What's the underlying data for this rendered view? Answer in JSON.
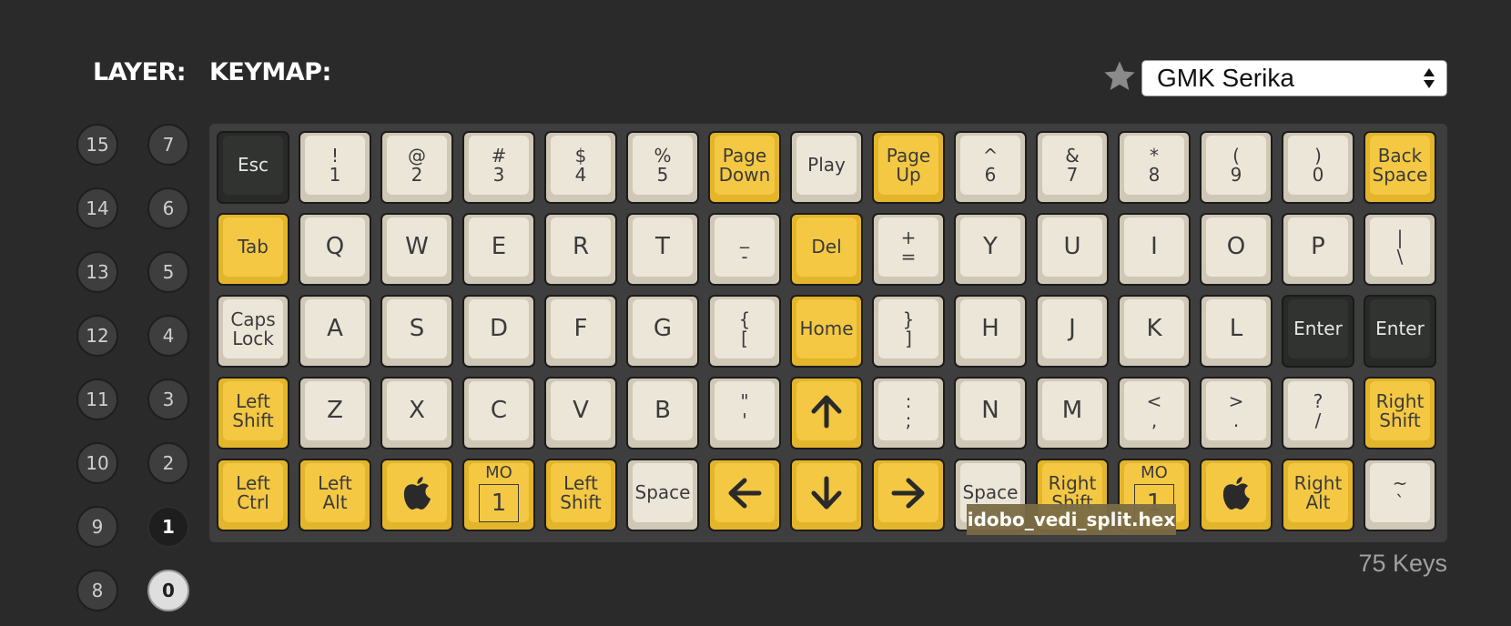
{
  "header": {
    "layer_label": "LAYER:",
    "keymap_label": "KEYMAP:"
  },
  "theme_select": {
    "value": "GMK Serika"
  },
  "layers": {
    "left": [
      "15",
      "14",
      "13",
      "12",
      "11",
      "10",
      "9",
      "8"
    ],
    "right": [
      "7",
      "6",
      "5",
      "4",
      "3",
      "2",
      "1",
      "0"
    ],
    "selected": "0",
    "active": "1"
  },
  "colors": {
    "beige": "#ece6d9",
    "yellow": "#f4c843",
    "dark": "#303330",
    "tooltip": "#7a6c45"
  },
  "keys": [
    [
      {
        "label": "Esc",
        "color": "dark"
      },
      {
        "label": "!\n1",
        "color": "beige"
      },
      {
        "label": "@\n2",
        "color": "beige"
      },
      {
        "label": "#\n3",
        "color": "beige"
      },
      {
        "label": "$\n4",
        "color": "beige"
      },
      {
        "label": "%\n5",
        "color": "beige"
      },
      {
        "label": "Page\nDown",
        "color": "yellow"
      },
      {
        "label": "Play",
        "color": "beige"
      },
      {
        "label": "Page\nUp",
        "color": "yellow"
      },
      {
        "label": "^\n6",
        "color": "beige"
      },
      {
        "label": "&\n7",
        "color": "beige"
      },
      {
        "label": "*\n8",
        "color": "beige"
      },
      {
        "label": "(\n9",
        "color": "beige"
      },
      {
        "label": ")\n0",
        "color": "beige"
      },
      {
        "label": "Back\nSpace",
        "color": "yellow"
      }
    ],
    [
      {
        "label": "Tab",
        "color": "yellow"
      },
      {
        "label": "Q",
        "color": "beige",
        "big": true
      },
      {
        "label": "W",
        "color": "beige",
        "big": true
      },
      {
        "label": "E",
        "color": "beige",
        "big": true
      },
      {
        "label": "R",
        "color": "beige",
        "big": true
      },
      {
        "label": "T",
        "color": "beige",
        "big": true
      },
      {
        "label": "_\n-",
        "color": "beige"
      },
      {
        "label": "Del",
        "color": "yellow"
      },
      {
        "label": "+\n=",
        "color": "beige"
      },
      {
        "label": "Y",
        "color": "beige",
        "big": true
      },
      {
        "label": "U",
        "color": "beige",
        "big": true
      },
      {
        "label": "I",
        "color": "beige",
        "big": true
      },
      {
        "label": "O",
        "color": "beige",
        "big": true
      },
      {
        "label": "P",
        "color": "beige",
        "big": true
      },
      {
        "label": "|\n\\",
        "color": "beige"
      }
    ],
    [
      {
        "label": "Caps\nLock",
        "color": "beige"
      },
      {
        "label": "A",
        "color": "beige",
        "big": true
      },
      {
        "label": "S",
        "color": "beige",
        "big": true
      },
      {
        "label": "D",
        "color": "beige",
        "big": true
      },
      {
        "label": "F",
        "color": "beige",
        "big": true
      },
      {
        "label": "G",
        "color": "beige",
        "big": true
      },
      {
        "label": "{\n[",
        "color": "beige"
      },
      {
        "label": "Home",
        "color": "yellow"
      },
      {
        "label": "}\n]",
        "color": "beige"
      },
      {
        "label": "H",
        "color": "beige",
        "big": true
      },
      {
        "label": "J",
        "color": "beige",
        "big": true
      },
      {
        "label": "K",
        "color": "beige",
        "big": true
      },
      {
        "label": "L",
        "color": "beige",
        "big": true
      },
      {
        "label": "Enter",
        "color": "dark"
      },
      {
        "label": "Enter",
        "color": "dark"
      }
    ],
    [
      {
        "label": "Left\nShift",
        "color": "yellow"
      },
      {
        "label": "Z",
        "color": "beige",
        "big": true
      },
      {
        "label": "X",
        "color": "beige",
        "big": true
      },
      {
        "label": "C",
        "color": "beige",
        "big": true
      },
      {
        "label": "V",
        "color": "beige",
        "big": true
      },
      {
        "label": "B",
        "color": "beige",
        "big": true
      },
      {
        "label": "\"\n'",
        "color": "beige"
      },
      {
        "label": "",
        "icon": "arrow-up-icon",
        "color": "yellow"
      },
      {
        "label": ":\n;",
        "color": "beige"
      },
      {
        "label": "N",
        "color": "beige",
        "big": true
      },
      {
        "label": "M",
        "color": "beige",
        "big": true
      },
      {
        "label": "<\n,",
        "color": "beige"
      },
      {
        "label": ">\n.",
        "color": "beige"
      },
      {
        "label": "?\n/",
        "color": "beige"
      },
      {
        "label": "Right\nShift",
        "color": "yellow"
      }
    ],
    [
      {
        "label": "Left\nCtrl",
        "color": "yellow"
      },
      {
        "label": "Left Alt",
        "color": "yellow"
      },
      {
        "label": "",
        "icon": "apple-icon",
        "color": "yellow"
      },
      {
        "label": "MO",
        "mo": "1",
        "color": "yellow"
      },
      {
        "label": "Left\nShift",
        "color": "yellow"
      },
      {
        "label": "Space",
        "color": "beige"
      },
      {
        "label": "",
        "icon": "arrow-left-icon",
        "color": "yellow"
      },
      {
        "label": "",
        "icon": "arrow-down-icon",
        "color": "yellow"
      },
      {
        "label": "",
        "icon": "arrow-right-icon",
        "color": "yellow"
      },
      {
        "label": "Space",
        "color": "beige"
      },
      {
        "label": "Right\nShift",
        "color": "yellow"
      },
      {
        "label": "MO",
        "mo": "1",
        "color": "yellow"
      },
      {
        "label": "",
        "icon": "apple-icon",
        "color": "yellow"
      },
      {
        "label": "Right\nAlt",
        "color": "yellow"
      },
      {
        "label": "~\n`",
        "color": "beige"
      }
    ]
  ],
  "tooltip": {
    "text": "idobo_vedi_split.hex"
  },
  "footer": {
    "key_count": "75 Keys"
  }
}
